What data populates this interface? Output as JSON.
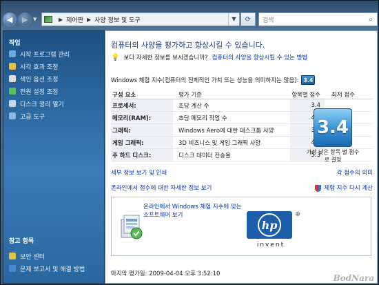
{
  "address": {
    "crumbs": [
      "제어판",
      "사양 정보 및 도구"
    ],
    "search_placeholder": "검색"
  },
  "sidebar": {
    "tasks_heading": "작업",
    "items": [
      {
        "label": "시작 프로그램 관리",
        "color": "#6aa8e0"
      },
      {
        "label": "시각 효과 조정",
        "color": "#e8c040"
      },
      {
        "label": "색인 옵션 조정",
        "color": "#e0e0e0"
      },
      {
        "label": "전원 설정 조정",
        "color": "#58c058"
      },
      {
        "label": "디스크 정리 열기",
        "color": "#c8d8e8"
      },
      {
        "label": "고급 도구",
        "color": "#8ab8e8"
      }
    ],
    "see_also_heading": "참고 항목",
    "see_also": [
      {
        "label": "보안 센터",
        "color": "#e8c040"
      },
      {
        "label": "문제 보고서 및 해결 방법",
        "color": "#4a88d0"
      }
    ]
  },
  "main": {
    "title": "컴퓨터의 사양을 평가하고 향상시킬 수 있습니다.",
    "hint_text": "보다 자세한 정보를 보시겠습니까?",
    "hint_link": "컴퓨터의 사양을 향상시킬 수 있는 방법",
    "wei_text": "Windows 체험 지수(컴퓨터의 전체적인 가치 또는 성능을 의미하지는 않음):",
    "wei_badge": "3.4",
    "table": {
      "headers": [
        "구성 요소",
        "평가 기준",
        "항목별 점수",
        "최저 점수"
      ],
      "rows": [
        {
          "component": "프로세서:",
          "criteria": "초당 계산 수",
          "score": "3.4"
        },
        {
          "component": "메모리(RAM):",
          "criteria": "초당 메모리 작업 수",
          "score": "4.5"
        },
        {
          "component": "그래픽:",
          "criteria": "Windows Aero에 대한 데스크톱 사양",
          "score": "3.9"
        },
        {
          "component": "게임 그래픽:",
          "criteria": "3D 비즈니스 및 게임 그래픽 사양",
          "score": "4.1"
        },
        {
          "component": "주 하드 디스크:",
          "criteria": "디스크 데이터 전송율",
          "score": "5.3"
        }
      ]
    },
    "base_score": "3.4",
    "base_note": "가장 낮은 항목 별 점수로 결정",
    "link_details": "세부 정보 보기 및 인쇄",
    "link_meaning": "각 점수의 의미",
    "link_online": "온라인에서 점수에 대한 자세한 정보 보기",
    "link_rerun": "체험 지수 다시 계산",
    "ad_link": "온라인에서 Windows 체험 지수에 맞는 소프트웨어 보기",
    "hp_logo_text": "hp",
    "hp_reg": "®",
    "hp_invent": "invent",
    "last_assessed": "마지막 평가일: 2009-04-04 오후 3:52:10"
  },
  "watermark": "BodNara",
  "colors": {
    "accent": "#1e3e8a",
    "link": "#0033cc",
    "sidebar": "#2a669e"
  }
}
